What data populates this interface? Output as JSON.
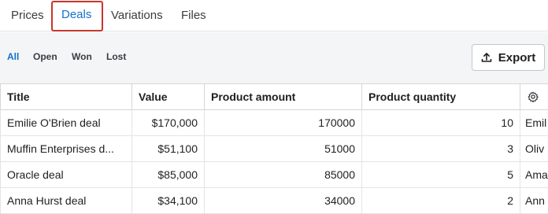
{
  "tabs": [
    {
      "label": "Prices",
      "active": false
    },
    {
      "label": "Deals",
      "active": true
    },
    {
      "label": "Variations",
      "active": false
    },
    {
      "label": "Files",
      "active": false
    }
  ],
  "filters": [
    {
      "label": "All",
      "active": true
    },
    {
      "label": "Open",
      "active": false
    },
    {
      "label": "Won",
      "active": false
    },
    {
      "label": "Lost",
      "active": false
    }
  ],
  "export_label": "Export",
  "table": {
    "columns": [
      "Title",
      "Value",
      "Product amount",
      "Product quantity"
    ],
    "rows": [
      {
        "title": "Emilie O'Brien deal",
        "value": "$170,000",
        "amount": "170000",
        "quantity": "10",
        "extra": "Emil"
      },
      {
        "title": "Muffin Enterprises d...",
        "value": "$51,100",
        "amount": "51000",
        "quantity": "3",
        "extra": "Oliv"
      },
      {
        "title": "Oracle deal",
        "value": "$85,000",
        "amount": "85000",
        "quantity": "5",
        "extra": "Ama"
      },
      {
        "title": "Anna Hurst deal",
        "value": "$34,100",
        "amount": "34000",
        "quantity": "2",
        "extra": "Ann"
      }
    ]
  },
  "colors": {
    "accent": "#1570c9",
    "highlight": "#c8352b"
  },
  "icons": {
    "export": "upload-icon",
    "settings": "gear-icon"
  }
}
